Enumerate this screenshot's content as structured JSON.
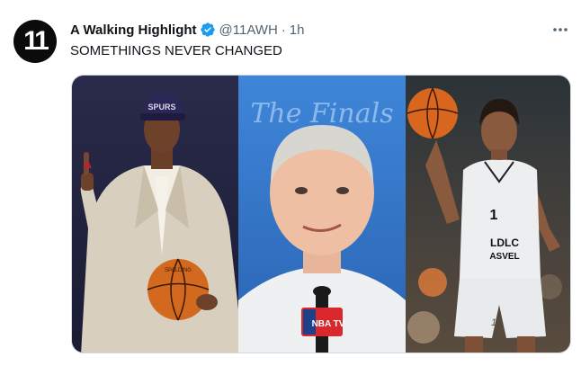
{
  "author": {
    "display_name": "A Walking Highlight",
    "handle": "@11AWH",
    "separator": "·",
    "time_ago": "1h",
    "avatar_text": "11"
  },
  "tweet": {
    "text": "SOMETHINGS NEVER CHANGED"
  },
  "media": {
    "panels": [
      {
        "cap_text": "SPURS",
        "ball_text": "SPALDING"
      },
      {
        "backdrop_text": "The Finals",
        "mic_logo_text": "NBA TV"
      },
      {
        "jersey_number": "1",
        "jersey_text_1": "LDLC",
        "jersey_text_2": "ASVEL",
        "shorts_number": "1"
      }
    ]
  },
  "colors": {
    "verified": "#1d9bf0",
    "text_primary": "#0f1419",
    "text_secondary": "#536471"
  },
  "icons": [
    "verified-badge-icon",
    "more-options-icon"
  ]
}
